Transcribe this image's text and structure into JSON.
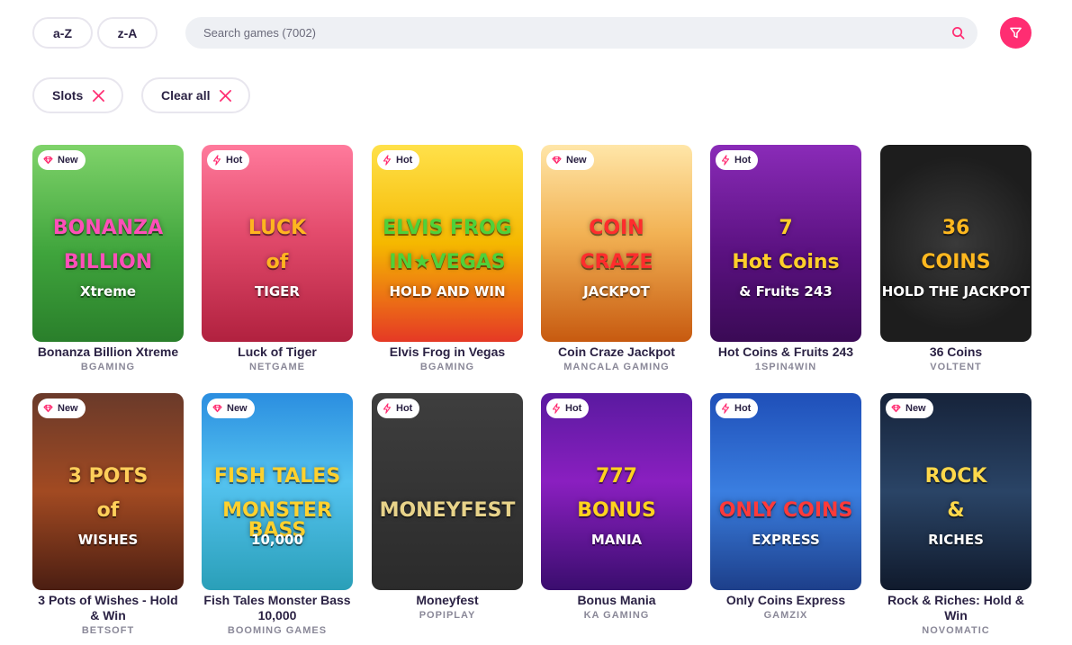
{
  "sort": {
    "az_label": "a-Z",
    "za_label": "z-A"
  },
  "search": {
    "placeholder": "Search games (7002)",
    "icon": "search-icon"
  },
  "filter": {
    "icon": "filter-icon",
    "color": "#ff2d72"
  },
  "chips": {
    "slots_label": "Slots",
    "clear_label": "Clear all"
  },
  "colors": {
    "accent": "#ff2d72",
    "text": "#2b2244",
    "muted": "#8a8898"
  },
  "games": [
    {
      "badge": "New",
      "badge_icon": "gem-icon",
      "name": "Bonanza Billion Xtreme",
      "provider": "BGAMING",
      "art": [
        "BONANZA",
        "BILLION",
        "Xtreme"
      ],
      "bg": "linear-gradient(180deg,#7fd36a 0%,#3fa43c 55%,#2a7f2b 100%)",
      "art_color": "#ff4fb8"
    },
    {
      "badge": "Hot",
      "badge_icon": "bolt-icon",
      "name": "Luck of Tiger",
      "provider": "NETGAME",
      "art": [
        "LUCK",
        "of",
        "TIGER"
      ],
      "bg": "linear-gradient(180deg,#ff7a9c 0%,#e34b6c 45%,#b1213f 100%)",
      "art_color": "#ffb520"
    },
    {
      "badge": "Hot",
      "badge_icon": "bolt-icon",
      "name": "Elvis Frog in Vegas",
      "provider": "BGAMING",
      "art": [
        "ELVIS FROG",
        "IN★VEGAS",
        "HOLD AND WIN"
      ],
      "bg": "linear-gradient(180deg,#ffe14a 0%,#f5b800 50%,#e53925 100%)",
      "art_color": "#4fd13a"
    },
    {
      "badge": "New",
      "badge_icon": "gem-icon",
      "name": "Coin Craze Jackpot",
      "provider": "MANCALA GAMING",
      "art": [
        "COIN",
        "CRAZE",
        "JACKPOT"
      ],
      "bg": "linear-gradient(180deg,#ffe6a8 0%,#f2b254 45%,#c75a10 100%)",
      "art_color": "#ff2d2d"
    },
    {
      "badge": "Hot",
      "badge_icon": "bolt-icon",
      "name": "Hot Coins & Fruits 243",
      "provider": "1SPIN4WIN",
      "art": [
        "7",
        "Hot Coins",
        "& Fruits 243"
      ],
      "bg": "linear-gradient(180deg,#8a2bb8 0%,#5a1180 55%,#3a0a55 100%)",
      "art_color": "#ffcf2a"
    },
    {
      "badge": "",
      "badge_icon": "",
      "name": "36 Coins",
      "provider": "VOLTENT",
      "art": [
        "36",
        "COINS",
        "HOLD THE JACKPOT"
      ],
      "bg": "radial-gradient(circle at 50% 50%,#3a3a3a 0%,#1d1d1d 70%)",
      "art_color": "#ffb81f"
    },
    {
      "badge": "New",
      "badge_icon": "gem-icon",
      "name": "3 Pots of Wishes - Hold & Win",
      "provider": "BETSOFT",
      "art": [
        "3 POTS",
        "of",
        "WISHES"
      ],
      "bg": "linear-gradient(180deg,#6a3a2a 0%,#a24a22 50%,#4b1e12 100%)",
      "art_color": "#ffcf5a"
    },
    {
      "badge": "New",
      "badge_icon": "gem-icon",
      "name": "Fish Tales Monster Bass 10,000",
      "provider": "BOOMING GAMES",
      "art": [
        "FISH TALES",
        "MONSTER BASS",
        "10,000"
      ],
      "bg": "linear-gradient(180deg,#2b8ee0 0%,#54c3f0 45%,#2a9fb8 100%)",
      "art_color": "#ffd12e"
    },
    {
      "badge": "Hot",
      "badge_icon": "bolt-icon",
      "name": "Moneyfest",
      "provider": "POPIPLAY",
      "art": [
        "",
        "MONEYFEST",
        ""
      ],
      "bg": "linear-gradient(180deg,#3e3e3e 0%,#2b2b2b 100%)",
      "art_color": "#e8d38a"
    },
    {
      "badge": "Hot",
      "badge_icon": "bolt-icon",
      "name": "Bonus Mania",
      "provider": "KA GAMING",
      "art": [
        "777",
        "BONUS",
        "MANIA"
      ],
      "bg": "linear-gradient(180deg,#5a1aa0 0%,#8a1fc0 45%,#3a0d6e 100%)",
      "art_color": "#ffd21e"
    },
    {
      "badge": "Hot",
      "badge_icon": "bolt-icon",
      "name": "Only Coins Express",
      "provider": "GAMZIX",
      "art": [
        "",
        "ONLY COINS",
        "EXPRESS"
      ],
      "bg": "linear-gradient(180deg,#1f4fb8 0%,#3a7ee0 50%,#1d3f8a 100%)",
      "art_color": "#ff3a3a"
    },
    {
      "badge": "New",
      "badge_icon": "gem-icon",
      "name": "Rock & Riches: Hold & Win",
      "provider": "NOVOMATIC",
      "art": [
        "ROCK",
        "&",
        "RICHES"
      ],
      "bg": "linear-gradient(180deg,#16233a 0%,#2a4466 50%,#101a2c 100%)",
      "art_color": "#ffd84a"
    }
  ]
}
